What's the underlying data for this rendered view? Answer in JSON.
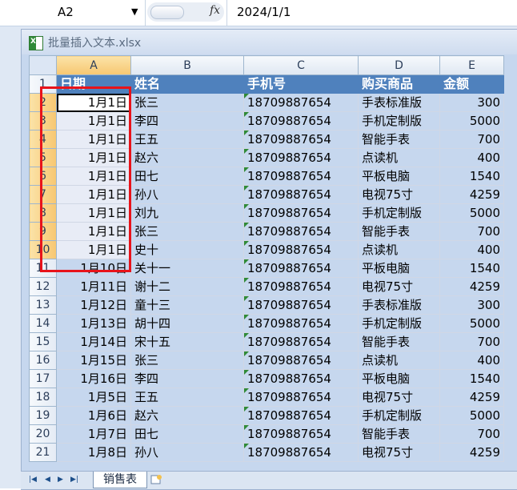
{
  "formula_bar": {
    "name_box": "A2",
    "fx": "fx",
    "value": "2024/1/1"
  },
  "workbook": {
    "title": "批量插入文本.xlsx"
  },
  "columns": [
    "A",
    "B",
    "C",
    "D",
    "E"
  ],
  "header_row": {
    "num": "1",
    "cells": [
      "日期",
      "姓名",
      "手机号",
      "购买商品",
      "金额"
    ]
  },
  "rows": [
    {
      "num": "2",
      "cells": [
        "1月1日",
        "张三",
        "18709887654",
        "手表标准版",
        "300"
      ]
    },
    {
      "num": "3",
      "cells": [
        "1月1日",
        "李四",
        "18709887654",
        "手机定制版",
        "5000"
      ]
    },
    {
      "num": "4",
      "cells": [
        "1月1日",
        "王五",
        "18709887654",
        "智能手表",
        "700"
      ]
    },
    {
      "num": "5",
      "cells": [
        "1月1日",
        "赵六",
        "18709887654",
        "点读机",
        "400"
      ]
    },
    {
      "num": "6",
      "cells": [
        "1月1日",
        "田七",
        "18709887654",
        "平板电脑",
        "1540"
      ]
    },
    {
      "num": "7",
      "cells": [
        "1月1日",
        "孙八",
        "18709887654",
        "电视75寸",
        "4259"
      ]
    },
    {
      "num": "8",
      "cells": [
        "1月1日",
        "刘九",
        "18709887654",
        "手机定制版",
        "5000"
      ]
    },
    {
      "num": "9",
      "cells": [
        "1月1日",
        "张三",
        "18709887654",
        "智能手表",
        "700"
      ]
    },
    {
      "num": "10",
      "cells": [
        "1月1日",
        "史十",
        "18709887654",
        "点读机",
        "400"
      ]
    },
    {
      "num": "11",
      "cells": [
        "1月10日",
        "关十一",
        "18709887654",
        "平板电脑",
        "1540"
      ]
    },
    {
      "num": "12",
      "cells": [
        "1月11日",
        "谢十二",
        "18709887654",
        "电视75寸",
        "4259"
      ]
    },
    {
      "num": "13",
      "cells": [
        "1月12日",
        "童十三",
        "18709887654",
        "手表标准版",
        "300"
      ]
    },
    {
      "num": "14",
      "cells": [
        "1月13日",
        "胡十四",
        "18709887654",
        "手机定制版",
        "5000"
      ]
    },
    {
      "num": "15",
      "cells": [
        "1月14日",
        "宋十五",
        "18709887654",
        "智能手表",
        "700"
      ]
    },
    {
      "num": "16",
      "cells": [
        "1月15日",
        "张三",
        "18709887654",
        "点读机",
        "400"
      ]
    },
    {
      "num": "17",
      "cells": [
        "1月16日",
        "李四",
        "18709887654",
        "平板电脑",
        "1540"
      ]
    },
    {
      "num": "18",
      "cells": [
        "1月5日",
        "王五",
        "18709887654",
        "电视75寸",
        "4259"
      ]
    },
    {
      "num": "19",
      "cells": [
        "1月6日",
        "赵六",
        "18709887654",
        "手机定制版",
        "5000"
      ]
    },
    {
      "num": "20",
      "cells": [
        "1月7日",
        "田七",
        "18709887654",
        "智能手表",
        "700"
      ]
    },
    {
      "num": "21",
      "cells": [
        "1月8日",
        "孙八",
        "18709887654",
        "电视75寸",
        "4259"
      ]
    }
  ],
  "sheet_tabs": [
    {
      "label": "销售表",
      "active": true
    }
  ],
  "colors": {
    "header_fill": "#4f81bd",
    "selection_highlight": "#f7c771",
    "annotation_box": "#e8131a"
  }
}
